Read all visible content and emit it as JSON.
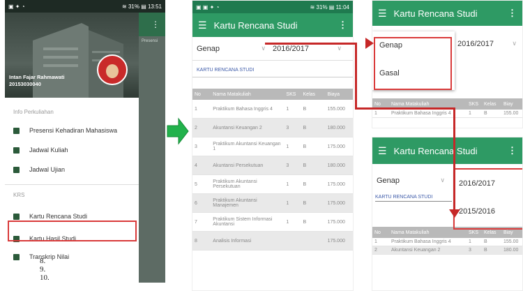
{
  "panel1": {
    "status_left": "▣ ✦ ◔",
    "status_right": "≋ 31% ▤ 13:51",
    "profile_name": "Intan Fajar Rahmawati",
    "profile_id": "20153030040",
    "background_tab": "Presensi",
    "section_info": "Info Perkuliahan",
    "items_info": [
      "Presensi Kehadiran Mahasiswa",
      "Jadwal Kuliah",
      "Jadwal Ujian"
    ],
    "section_krs": "KRS",
    "items_krs": [
      "Kartu Rencana Studi",
      "Kartu Hasil Studi",
      "Transkrip Nilai"
    ],
    "numbers": [
      "8.",
      "9.",
      "10."
    ],
    "colors": {
      "dark_header": "#2b3a33",
      "accent_green": "#2e9a64",
      "highlight": "#d93a3a"
    }
  },
  "panel2": {
    "status_left": "▣ ▣ ✦ ◔",
    "status_right": "≋ 31% ▤ 11:04",
    "title": "Kartu Rencana Studi",
    "menu_icon": "hamburger-icon",
    "overflow_icon": "more-vert-icon",
    "semester": "Genap",
    "year": "2016/2017",
    "link": "KARTU RENCANA STUDI",
    "columns": [
      "No",
      "Nama Matakuliah",
      "SKS",
      "Kelas",
      "Biaya"
    ],
    "rows": [
      [
        "1",
        "Praktikum Bahasa Inggris 4",
        "1",
        "B",
        "155.000"
      ],
      [
        "2",
        "Akuntansi Keuangan 2",
        "3",
        "B",
        "180.000"
      ],
      [
        "3",
        "Praktikum Akuntansi Keuangan 1",
        "1",
        "B",
        "175.000"
      ],
      [
        "4",
        "Akuntansi Persekutuan",
        "3",
        "B",
        "180.000"
      ],
      [
        "5",
        "Praktikum Akuntansi Persekutuan",
        "1",
        "B",
        "175.000"
      ],
      [
        "6",
        "Praktikum Akuntansi Manajemen",
        "1",
        "B",
        "175.000"
      ],
      [
        "7",
        "Praktikum Sistem Informasi Akuntansi",
        "1",
        "B",
        "175.000"
      ],
      [
        "8",
        "Analisis Informasi",
        "",
        "",
        "175.000"
      ]
    ]
  },
  "panel3": {
    "title": "Kartu Rencana Studi",
    "year": "2016/2017",
    "options": [
      "Genap",
      "Gasal"
    ],
    "columns": [
      "No",
      "Nama Matakuliah",
      "SKS",
      "Kelas",
      "Biay"
    ],
    "rows": [
      [
        "1",
        "Praktikum Bahasa Inggris 4",
        "1",
        "B",
        "155.00"
      ]
    ]
  },
  "panel4": {
    "title": "Kartu Rencana Studi",
    "semester": "Genap",
    "link": "KARTU RENCANA STUDI",
    "year_options": [
      "2016/2017",
      "2015/2016"
    ],
    "columns": [
      "No",
      "Nama Matakuliah",
      "SKS",
      "Kelas",
      "Biay"
    ],
    "rows": [
      [
        "1",
        "Praktikum Bahasa Inggris 4",
        "1",
        "B",
        "155.00"
      ],
      [
        "2",
        "Akuntansi Keuangan 2",
        "3",
        "B",
        "180.00"
      ]
    ]
  }
}
